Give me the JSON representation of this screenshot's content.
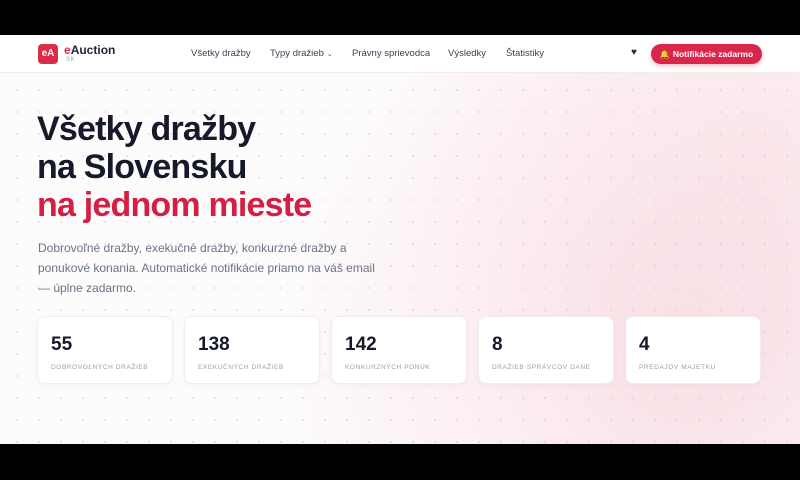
{
  "brand": {
    "mark": "eA",
    "name_prefix": "e",
    "name_rest": "Auction",
    "sub": "SK",
    "accent_color": "#dc2c4a"
  },
  "nav": {
    "links": [
      {
        "label": "Všetky dražby"
      },
      {
        "label": "Typy dražieb",
        "has_dropdown": true
      },
      {
        "label": "Právny sprievodca"
      },
      {
        "label": "Výsledky"
      },
      {
        "label": "Štatistiky"
      }
    ],
    "favorites_icon": "heart-icon",
    "cta_icon": "bell-icon",
    "cta_label": "Notifikácie zadarmo"
  },
  "hero": {
    "title_line1": "Všetky dražby",
    "title_line2": "na Slovensku",
    "title_line3": "na jednom mieste",
    "description": "Dobrovoľné dražby, exekučné dražby, konkurzné dražby a ponukové konania. Automatické notifikácie priamo na váš email — úplne zadarmo."
  },
  "stats": [
    {
      "value": "55",
      "label": "DOBROVOĽNÝCH DRAŽIEB"
    },
    {
      "value": "138",
      "label": "EXEKUČNÝCH DRAŽIEB"
    },
    {
      "value": "142",
      "label": "KONKURZNÝCH PONÚK"
    },
    {
      "value": "8",
      "label": "DRAŽIEB SPRÁVCOV DANE"
    },
    {
      "value": "4",
      "label": "PREDAJOV MAJETKU"
    }
  ]
}
